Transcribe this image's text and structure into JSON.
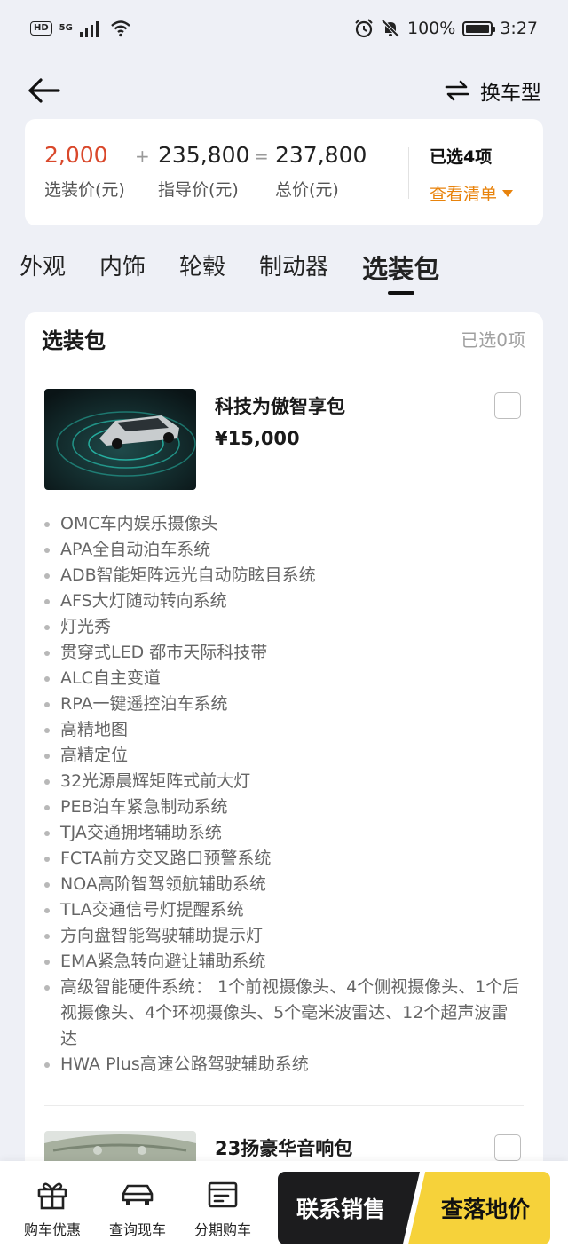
{
  "status_bar": {
    "hd": "HD",
    "network": "5G",
    "battery": "100%",
    "time": "3:27"
  },
  "nav": {
    "switch_label": "换车型"
  },
  "price_summary": {
    "option_price": "2,000",
    "option_label": "选装价(元)",
    "plus": "+",
    "guide_price": "235,800",
    "guide_label": "指导价(元)",
    "equals": "=",
    "total_price": "237,800",
    "total_label": "总价(元)",
    "selected_count": "已选4项",
    "view_list": "查看清单"
  },
  "tabs": [
    {
      "label": "外观"
    },
    {
      "label": "内饰"
    },
    {
      "label": "轮毂"
    },
    {
      "label": "制动器"
    },
    {
      "label": "选装包"
    }
  ],
  "active_tab": 4,
  "packages": {
    "title": "选装包",
    "selected": "已选0项",
    "items": [
      {
        "name": "科技为傲智享包",
        "price": "¥15,000",
        "checked": false,
        "features": [
          "OMC车内娱乐摄像头",
          "APA全自动泊车系统",
          "ADB智能矩阵远光自动防眩目系统",
          "AFS大灯随动转向系统",
          "灯光秀",
          "贯穿式LED 都市天际科技带",
          "ALC自主变道",
          "RPA一键遥控泊车系统",
          "高精地图",
          "高精定位",
          "32光源晨辉矩阵式前大灯",
          "PEB泊车紧急制动系统",
          "TJA交通拥堵辅助系统",
          "FCTA前方交叉路口预警系统",
          "NOA高阶智驾领航辅助系统",
          "TLA交通信号灯提醒系统",
          "方向盘智能驾驶辅助提示灯",
          "EMA紧急转向避让辅助系统",
          "高级智能硬件系统： 1个前视摄像头、4个侧视摄像头、1个后视摄像头、4个环视摄像头、5个毫米波雷达、12个超声波雷达",
          "HWA Plus高速公路驾驶辅助系统"
        ]
      },
      {
        "name": "23扬豪华音响包",
        "checked": false
      }
    ]
  },
  "bottom_bar": {
    "items": [
      {
        "label": "购车优惠",
        "icon": "gift-icon"
      },
      {
        "label": "查询现车",
        "icon": "car-icon"
      },
      {
        "label": "分期购车",
        "icon": "installment-icon"
      }
    ],
    "contact_sales": "联系销售",
    "check_price": "查落地价"
  },
  "colors": {
    "accent_orange": "#e8830c",
    "option_price_red": "#d9482b",
    "cta_yellow": "#f6d23a",
    "cta_dark": "#1c1c1e"
  }
}
